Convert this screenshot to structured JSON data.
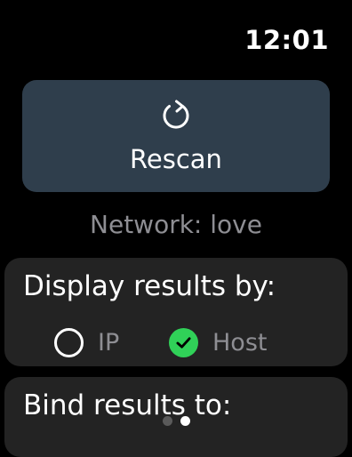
{
  "status_bar": {
    "time": "12:01"
  },
  "rescan_button": {
    "icon": "refresh-icon",
    "label": "Rescan"
  },
  "network": {
    "text": "Network: love"
  },
  "display_results": {
    "title": "Display results by:",
    "options": [
      {
        "label": "IP",
        "selected": false,
        "icon": "radio-empty-icon"
      },
      {
        "label": "Host",
        "selected": true,
        "icon": "checkmark-circle-icon"
      }
    ]
  },
  "bind_results": {
    "title": "Bind results to:"
  },
  "page_indicator": {
    "pages": 2,
    "current": 2
  },
  "colors": {
    "background": "#000000",
    "button_bg": "#2f3e4c",
    "card_bg": "#232323",
    "accent_green": "#30d158",
    "secondary_text": "#8e8e93"
  }
}
